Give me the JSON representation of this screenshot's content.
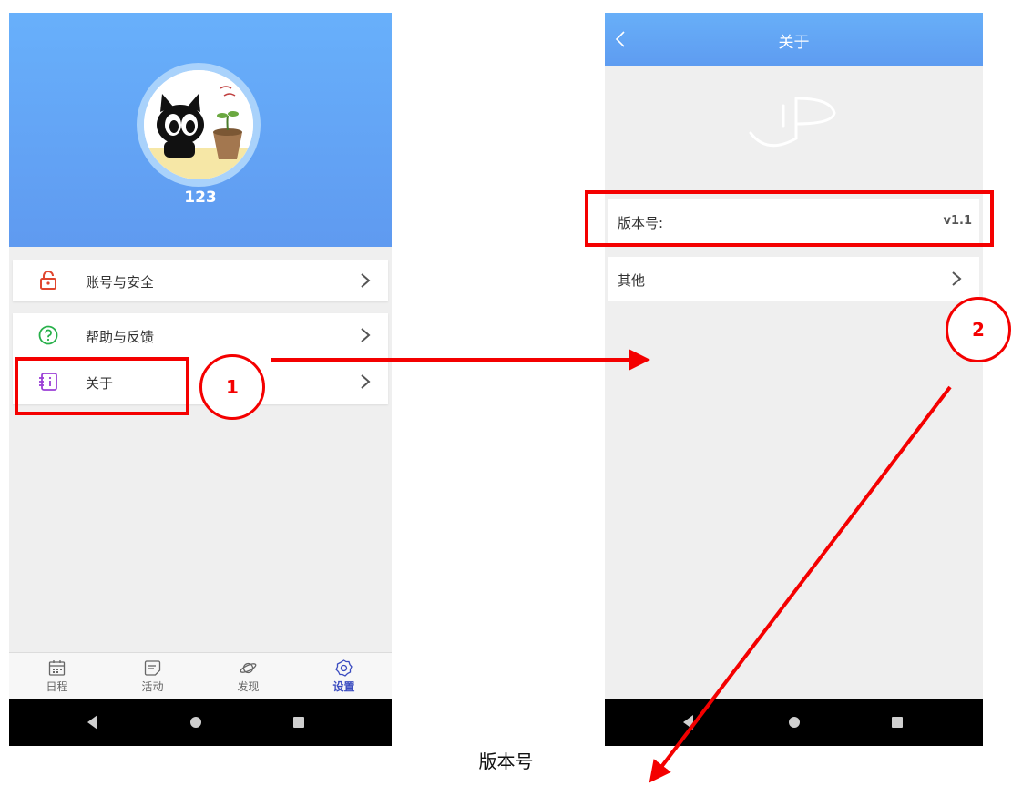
{
  "left_screen": {
    "profile": {
      "username": "123"
    },
    "menu": [
      {
        "label": "账号与安全",
        "icon": "unlock-icon",
        "color": "#e0462e"
      },
      {
        "label": "帮助与反馈",
        "icon": "help-circle-icon",
        "color": "#27b04a"
      },
      {
        "label": "关于",
        "icon": "info-icon",
        "color": "#9b3fd6"
      }
    ],
    "tabs": [
      {
        "label": "日程",
        "icon": "calendar-icon",
        "active": false
      },
      {
        "label": "活动",
        "icon": "message-icon",
        "active": false
      },
      {
        "label": "发现",
        "icon": "planet-icon",
        "active": false
      },
      {
        "label": "设置",
        "icon": "gear-icon",
        "active": true
      }
    ]
  },
  "right_screen": {
    "header": {
      "title": "关于"
    },
    "rows": [
      {
        "label": "版本号:",
        "value": "v1.1"
      },
      {
        "label": "其他"
      }
    ]
  },
  "annotations": {
    "step1": "1",
    "step2": "2",
    "accent_color": "#f40000"
  },
  "caption": "版本号"
}
